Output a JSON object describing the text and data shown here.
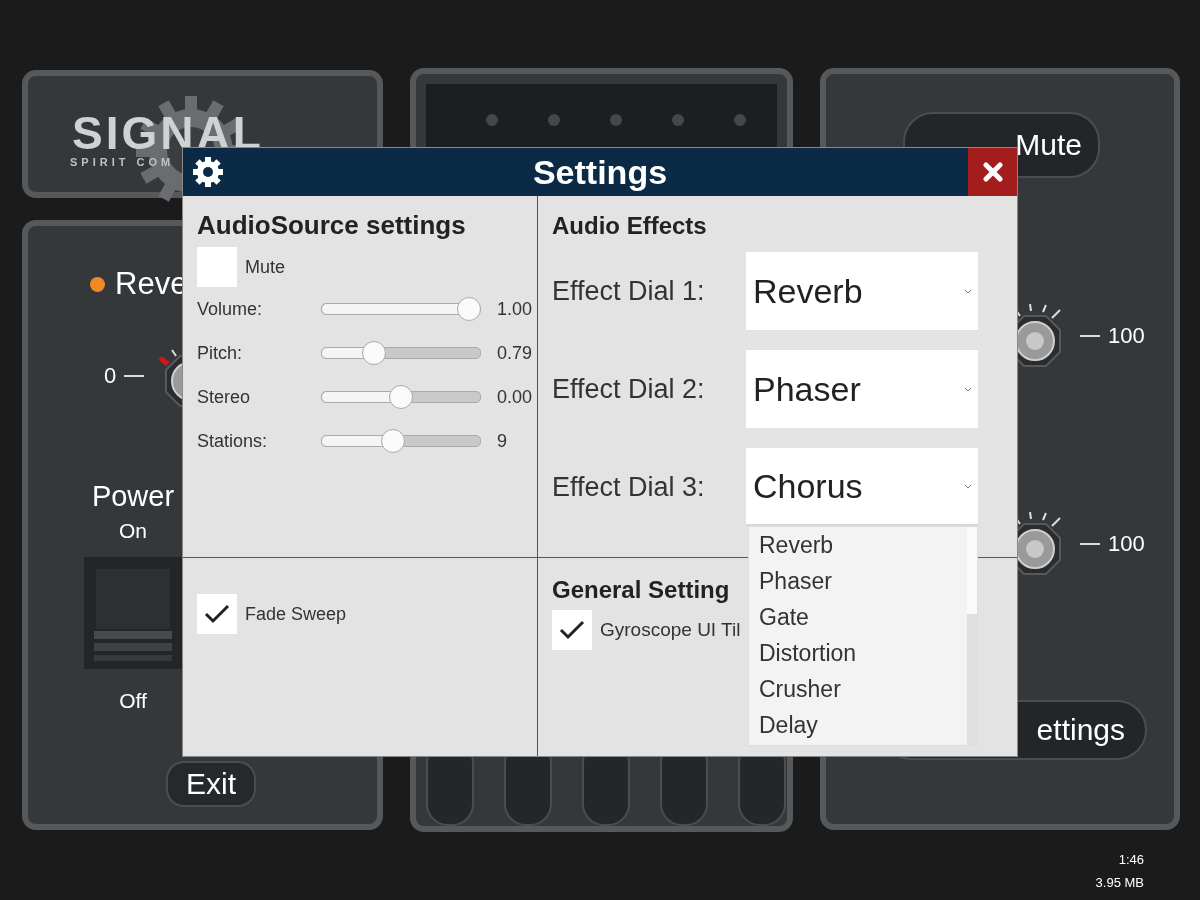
{
  "background": {
    "logo": "SIGNAL",
    "logo_subtitle": "SPIRIT COM",
    "left_panel": {
      "effect_label": "Reve",
      "knob_min": "0",
      "power_label": "Power",
      "power_on": "On",
      "power_switch": {
        "on": false
      },
      "power_off": "Off",
      "exit_button": "Exit"
    },
    "right_panel": {
      "mute_button": "Mute",
      "knob_max": [
        "100",
        "100"
      ],
      "settings_button": "ettings"
    }
  },
  "dialog": {
    "title": "Settings",
    "audio_source": {
      "heading": "AudioSource settings",
      "mute": {
        "label": "Mute",
        "checked": false
      },
      "sliders": [
        {
          "label": "Volume:",
          "level": 1.0,
          "reading": "1.00"
        },
        {
          "label": "Pitch:",
          "level": 0.3,
          "reading": "0.79"
        },
        {
          "label": "Stereo",
          "level": 0.5,
          "reading": "0.00"
        },
        {
          "label": "Stations:",
          "level": 0.44,
          "reading": "9"
        }
      ]
    },
    "fade_sweep": {
      "label": "Fade Sweep",
      "checked": true
    },
    "audio_effects": {
      "heading": "Audio Effects",
      "dials": [
        {
          "label": "Effect Dial 1:",
          "value": "Reverb",
          "open": false
        },
        {
          "label": "Effect Dial 2:",
          "value": "Phaser",
          "open": false
        },
        {
          "label": "Effect Dial 3:",
          "value": "Chorus",
          "open": true
        }
      ],
      "options": [
        "Reverb",
        "Phaser",
        "Gate",
        "Distortion",
        "Crusher",
        "Delay"
      ]
    },
    "general": {
      "heading": "General Setting",
      "gyroscope": {
        "label": "Gyroscope UI Til",
        "checked": true
      }
    }
  },
  "status": {
    "time": "1:46",
    "memory": "3.95 MB"
  }
}
